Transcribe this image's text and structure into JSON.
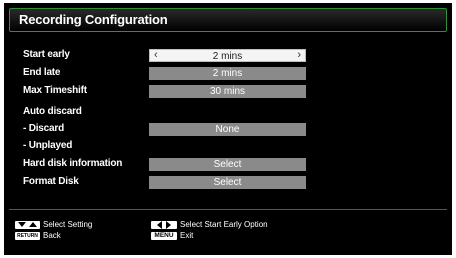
{
  "title": "Recording Configuration",
  "rows": [
    {
      "label": "Start early",
      "value": "2 mins",
      "selected": true
    },
    {
      "label": "End late",
      "value": "2 mins"
    },
    {
      "label": "Max Timeshift",
      "value": "30 mins"
    },
    {
      "label": "Auto discard",
      "value": null
    },
    {
      "label": "- Discard",
      "value": "None"
    },
    {
      "label": "- Unplayed",
      "value": null
    },
    {
      "label": "Hard disk information",
      "value": "Select"
    },
    {
      "label": "Format Disk",
      "value": "Select"
    }
  ],
  "footer": {
    "select_setting": "Select Setting",
    "back": "Back",
    "select_option": "Select Start Early Option",
    "exit": "Exit",
    "return_key": "RETURN",
    "menu_key": "MENU"
  },
  "colors": {
    "frame_border": "#2f8f3c",
    "field_bg": "#8a8a8a",
    "selected_field_bg": "#f4f4f4"
  }
}
